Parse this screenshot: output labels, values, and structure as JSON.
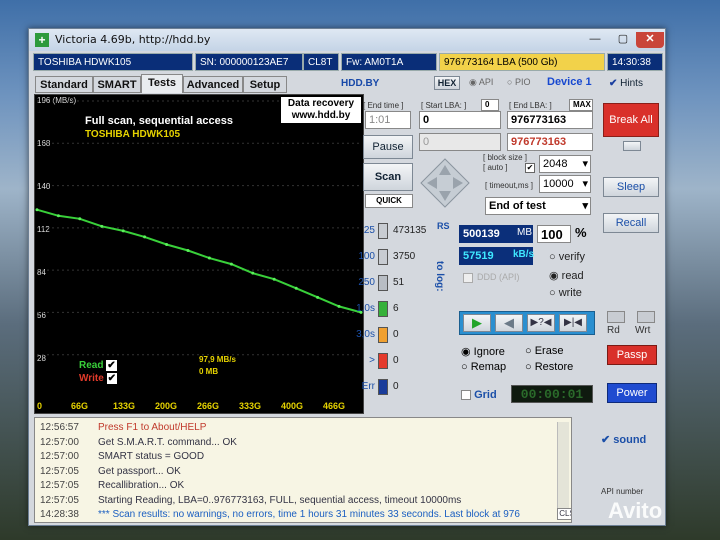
{
  "window": {
    "title": "Victoria 4.69b, http://hdd.by",
    "app_icon": "+",
    "buttons": {
      "minimize": "—",
      "maximize": "▢",
      "close": "✕"
    }
  },
  "info_bar": {
    "model": "TOSHIBA HDWK105",
    "serial": "SN: 000000123AE7",
    "cl": "CL8T",
    "firmware": "Fw: AM0T1A",
    "lba_size": "976773164 LBA (500 Gb)",
    "clock": "14:30:38"
  },
  "tabs": [
    "Standard",
    "SMART",
    "Tests",
    "Advanced",
    "Setup"
  ],
  "top_row": {
    "brand": "HDD.BY",
    "hex": "HEX",
    "api": "API",
    "pio": "PIO",
    "device": "Device 1",
    "hints": "Hints"
  },
  "graph": {
    "y_unit": "196 (MB/s)",
    "y_ticks": [
      "168",
      "140",
      "112",
      "84",
      "56",
      "28"
    ],
    "x_ticks": [
      "0",
      "66G",
      "133G",
      "200G",
      "266G",
      "333G",
      "400G",
      "466G"
    ],
    "scan_title": "Full scan, sequential access",
    "drive": "TOSHIBA HDWK105",
    "promo_line1": "Data recovery",
    "promo_line2": "www.hdd.by",
    "read_label": "Read",
    "write_label": "Write",
    "speed_now": "97,9 MB/s",
    "mb_now": "0 MB"
  },
  "chart_data": {
    "type": "line",
    "title": "Full scan, sequential access",
    "xlabel": "",
    "ylabel": "MB/s",
    "x_categories": [
      "0",
      "66G",
      "133G",
      "200G",
      "266G",
      "333G",
      "400G",
      "466G"
    ],
    "ylim": [
      0,
      196
    ],
    "series": [
      {
        "name": "Read",
        "x_gb": [
          0,
          33,
          66,
          100,
          133,
          166,
          200,
          233,
          266,
          300,
          333,
          366,
          400,
          433,
          466,
          500
        ],
        "y": [
          124,
          120,
          118,
          113,
          110,
          106,
          101,
          97,
          92,
          88,
          82,
          78,
          72,
          66,
          60,
          56
        ]
      }
    ]
  },
  "controls": {
    "end_time_label": "[ End time ]",
    "end_time_value": "1:01",
    "start_lba_label": "[ Start LBA: ]",
    "start_lba_zero": "0",
    "start_lba_value": "0",
    "start_lba_value2": "0",
    "end_lba_label": "[ End LBA: ]",
    "end_lba_max": "MAX",
    "end_lba_value": "976773163",
    "end_lba_value2": "976773163",
    "pause": "Pause",
    "scan": "Scan",
    "quick": "QUICK",
    "block_size_label": "[ block size ]",
    "block_auto": "[ auto ]",
    "block_size_value": "2048",
    "timeout_label": "[ timeout,ms ]",
    "timeout_value": "10000",
    "end_of_test": "End of test",
    "break_all": "Break All",
    "sleep": "Sleep",
    "recall": "Recall",
    "passp": "Passp",
    "power": "Power",
    "rd": "Rd",
    "wrt": "Wrt",
    "sound": "sound",
    "api_number": "API number",
    "cls": "CLS"
  },
  "histogram": {
    "rs": "RS",
    "to_log": "to log:",
    "rows": [
      {
        "label": "25",
        "count": "473135",
        "color": "#c8ccd2"
      },
      {
        "label": "100",
        "count": "3750",
        "color": "#c8ccd2"
      },
      {
        "label": "250",
        "count": "51",
        "color": "#b8bdc4"
      },
      {
        "label": "1,0s",
        "count": "6",
        "color": "#36b13a"
      },
      {
        "label": "3,0s",
        "count": "0",
        "color": "#f0a030"
      },
      {
        "label": ">",
        "count": "0",
        "color": "#e43a2c"
      },
      {
        "label": "Err",
        "count": "0",
        "color": "#1a3c9a"
      }
    ]
  },
  "stats": {
    "mb_done": "500139",
    "mb_unit": "MB",
    "percent": "100",
    "percent_sign": "%",
    "speed": "57519",
    "speed_unit": "kB/s",
    "ddd": "DDD (API)"
  },
  "modes": {
    "verify": "verify",
    "read": "read",
    "write": "write",
    "selected": "read"
  },
  "actions": {
    "ignore": "Ignore",
    "erase": "Erase",
    "remap": "Remap",
    "restore": "Restore",
    "grid": "Grid",
    "timer": "00:00:01"
  },
  "log": [
    {
      "time": "12:56:57",
      "msg": "Press F1 to About/HELP",
      "color": "#c0392b"
    },
    {
      "time": "12:57:00",
      "msg": "Get S.M.A.R.T. command... OK",
      "color": "#334"
    },
    {
      "time": "12:57:00",
      "msg": "SMART status = GOOD",
      "color": "#334"
    },
    {
      "time": "12:57:05",
      "msg": "Get passport... OK",
      "color": "#334"
    },
    {
      "time": "12:57:05",
      "msg": "Recallibration... OK",
      "color": "#334"
    },
    {
      "time": "12:57:05",
      "msg": "Starting Reading, LBA=0..976773163, FULL, sequential access, timeout 10000ms",
      "color": "#334"
    },
    {
      "time": "14:28:38",
      "msg": "*** Scan results: no warnings, no errors, time 1 hours 31 minutes 33 seconds. Last block at 976",
      "color": "#1b5fc1"
    }
  ],
  "watermark": "Avito"
}
